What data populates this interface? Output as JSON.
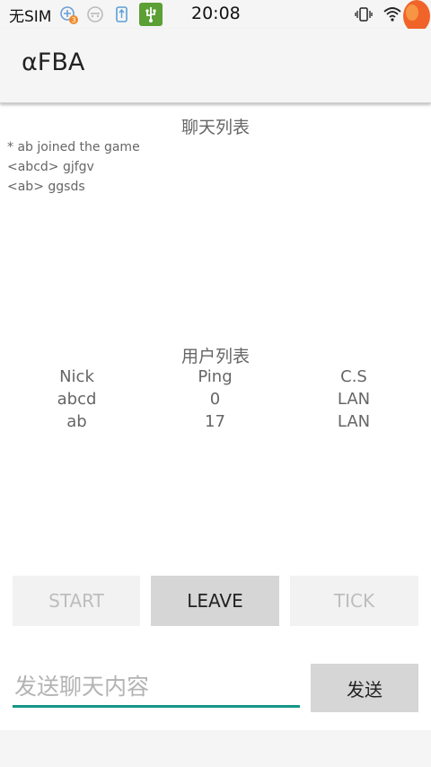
{
  "statusbar": {
    "carrier": "无SIM",
    "time": "20:08",
    "badge_count": "3"
  },
  "appbar": {
    "title": "αFBA"
  },
  "chat": {
    "title": "聊天列表",
    "messages": [
      "* ab joined the game",
      "<abcd> gjfgv",
      "<ab> ggsds"
    ]
  },
  "users": {
    "title": "用户列表",
    "headers": [
      "Nick",
      "Ping",
      "C.S"
    ],
    "rows": [
      [
        "abcd",
        "0",
        "LAN"
      ],
      [
        "ab",
        "17",
        "LAN"
      ]
    ]
  },
  "buttons": {
    "start": "START",
    "leave": "LEAVE",
    "tick": "TICK"
  },
  "input": {
    "placeholder": "发送聊天内容",
    "send_label": "发送"
  },
  "colors": {
    "accent": "#159688",
    "balloon": "#f0642a"
  }
}
